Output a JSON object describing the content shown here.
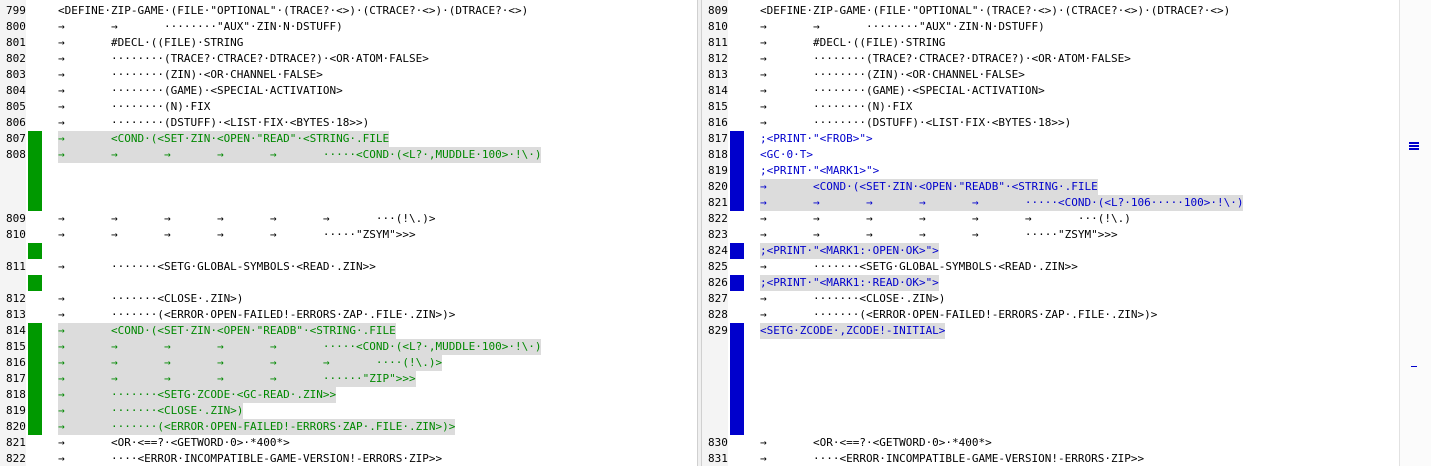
{
  "colors": {
    "left_change": "#009900",
    "right_change": "#0000cc",
    "highlight_bg": "#dcdcdc",
    "left_text_change": "#008800",
    "right_text_change": "#0000cc"
  },
  "left": {
    "lines": [
      {
        "n": "799",
        "t": "<DEFINE·ZIP-GAME·(FILE·\"OPTIONAL\"·(TRACE?·<>)·(CTRACE?·<>)·(DTRACE?·<>)"
      },
      {
        "n": "800",
        "t": "→       →       ········\"AUX\"·ZIN·N·DSTUFF)"
      },
      {
        "n": "801",
        "t": "→       #DECL·((FILE)·STRING"
      },
      {
        "n": "802",
        "t": "→       ········(TRACE?·CTRACE?·DTRACE?)·<OR·ATOM·FALSE>"
      },
      {
        "n": "803",
        "t": "→       ········(ZIN)·<OR·CHANNEL·FALSE>"
      },
      {
        "n": "804",
        "t": "→       ········(GAME)·<SPECIAL·ACTIVATION>"
      },
      {
        "n": "805",
        "t": "→       ········(N)·FIX"
      },
      {
        "n": "806",
        "t": "→       ········(DSTUFF)·<LIST·FIX·<BYTES·18>>)"
      },
      {
        "n": "807",
        "t": "→       <COND·(<SET·ZIN·<OPEN·\"READ\"·<STRING·.FILE"
      },
      {
        "n": "808",
        "t": "→       →       →       →       →       ·····<COND·(<L?·,MUDDLE·100>·!\\·)"
      },
      {
        "n": "809",
        "t": "→       →       →       →       →       →       ···(!\\.)>"
      },
      {
        "n": "810",
        "t": "→       →       →       →       →       ·····\"ZSYM\">>>"
      },
      {
        "n": "811",
        "t": "→       ·······<SETG·GLOBAL-SYMBOLS·<READ·.ZIN>>"
      },
      {
        "n": "812",
        "t": "→       ·······<CLOSE·.ZIN>)"
      },
      {
        "n": "813",
        "t": "→       ·······(<ERROR·OPEN-FAILED!-ERRORS·ZAP·.FILE·.ZIN>)>"
      },
      {
        "n": "814",
        "t": "→       <COND·(<SET·ZIN·<OPEN·\"READB\"·<STRING·.FILE"
      },
      {
        "n": "815",
        "t": "→       →       →       →       →       ·····<COND·(<L?·,MUDDLE·100>·!\\·)"
      },
      {
        "n": "816",
        "t": "→       →       →       →       →       →       ····(!\\.)>"
      },
      {
        "n": "817",
        "t": "→       →       →       →       →       ······\"ZIP\">>>"
      },
      {
        "n": "818",
        "t": "→       ·······<SETG·ZCODE·<GC-READ·.ZIN>>"
      },
      {
        "n": "819",
        "t": "→       ·······<CLOSE·.ZIN>)"
      },
      {
        "n": "820",
        "t": "→       ·······(<ERROR·OPEN-FAILED!-ERRORS·ZAP·.FILE·.ZIN>)>"
      },
      {
        "n": "821",
        "t": "→       <OR·<==?·<GETWORD·0>·*400*>"
      },
      {
        "n": "822",
        "t": "→       ····<ERROR·INCOMPATIBLE-GAME-VERSION!-ERRORS·ZIP>>"
      }
    ]
  },
  "right": {
    "lines": [
      {
        "n": "809",
        "t": "<DEFINE·ZIP-GAME·(FILE·\"OPTIONAL\"·(TRACE?·<>)·(CTRACE?·<>)·(DTRACE?·<>)"
      },
      {
        "n": "810",
        "t": "→       →       ········\"AUX\"·ZIN·N·DSTUFF)"
      },
      {
        "n": "811",
        "t": "→       #DECL·((FILE)·STRING"
      },
      {
        "n": "812",
        "t": "→       ········(TRACE?·CTRACE?·DTRACE?)·<OR·ATOM·FALSE>"
      },
      {
        "n": "813",
        "t": "→       ········(ZIN)·<OR·CHANNEL·FALSE>"
      },
      {
        "n": "814",
        "t": "→       ········(GAME)·<SPECIAL·ACTIVATION>"
      },
      {
        "n": "815",
        "t": "→       ········(N)·FIX"
      },
      {
        "n": "816",
        "t": "→       ········(DSTUFF)·<LIST·FIX·<BYTES·18>>)"
      },
      {
        "n": "817",
        "t": ";<PRINT·\"<FROB>\">"
      },
      {
        "n": "818",
        "t": "<GC·0·T>"
      },
      {
        "n": "819",
        "t": ";<PRINT·\"<MARK1>\">"
      },
      {
        "n": "820",
        "t": "→       <COND·(<SET·ZIN·<OPEN·\"READB\"·<STRING·.FILE"
      },
      {
        "n": "821",
        "t": "→       →       →       →       →       ·····<COND·(<L?·106·····100>·!\\·)"
      },
      {
        "n": "822",
        "t": "→       →       →       →       →       →       ···(!\\.)"
      },
      {
        "n": "823",
        "t": "→       →       →       →       →       ·····\"ZSYM\">>>"
      },
      {
        "n": "824",
        "t": ";<PRINT·\"<MARK1:·OPEN·OK>\">"
      },
      {
        "n": "825",
        "t": "→       ·······<SETG·GLOBAL-SYMBOLS·<READ·.ZIN>>"
      },
      {
        "n": "826",
        "t": ";<PRINT·\"<MARK1:·READ·OK>\">"
      },
      {
        "n": "827",
        "t": "→       ·······<CLOSE·.ZIN>)"
      },
      {
        "n": "828",
        "t": "→       ·······(<ERROR·OPEN-FAILED!-ERRORS·ZAP·.FILE·.ZIN>)>"
      },
      {
        "n": "829",
        "t": "<SETG·ZCODE·,ZCODE!-INITIAL>"
      },
      {
        "n": "830",
        "t": "→       <OR·<==?·<GETWORD·0>·*400*>"
      },
      {
        "n": "831",
        "t": "→       ····<ERROR·INCOMPATIBLE-GAME-VERSION!-ERRORS·ZIP>>"
      }
    ]
  }
}
